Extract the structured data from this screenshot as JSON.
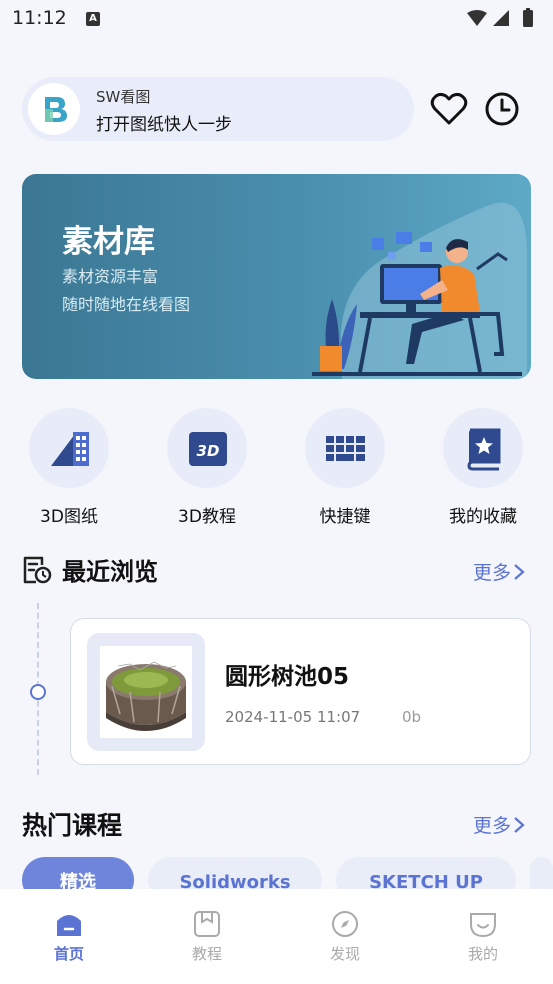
{
  "status_bar": {
    "time": "11:12",
    "notif": "A"
  },
  "app": {
    "name": "SW看图",
    "slogan": "打开图纸快人一步"
  },
  "banner": {
    "title": "素材库",
    "line1": "素材资源丰富",
    "line2": "随时随地在线看图"
  },
  "quick_actions": [
    {
      "label": "3D图纸",
      "icon": "3d-drawing-icon"
    },
    {
      "label": "3D教程",
      "icon": "3d-tutorial-icon"
    },
    {
      "label": "快捷键",
      "icon": "keyboard-icon"
    },
    {
      "label": "我的收藏",
      "icon": "favorites-book-icon"
    }
  ],
  "recent": {
    "title": "最近浏览",
    "more": "更多",
    "items": [
      {
        "name": "圆形树池05",
        "time": "2024-11-05 11:07",
        "size": "0b"
      }
    ]
  },
  "courses": {
    "title": "热门课程",
    "more": "更多",
    "chips": [
      "精选",
      "Solidworks",
      "SKETCH UP"
    ]
  },
  "tabbar": [
    {
      "label": "首页",
      "icon": "home-icon",
      "active": true
    },
    {
      "label": "教程",
      "icon": "tutorial-icon",
      "active": false
    },
    {
      "label": "发现",
      "icon": "compass-icon",
      "active": false
    },
    {
      "label": "我的",
      "icon": "profile-icon",
      "active": false
    }
  ],
  "colors": {
    "accent": "#5b74d3",
    "banner": "#4a8fae"
  }
}
